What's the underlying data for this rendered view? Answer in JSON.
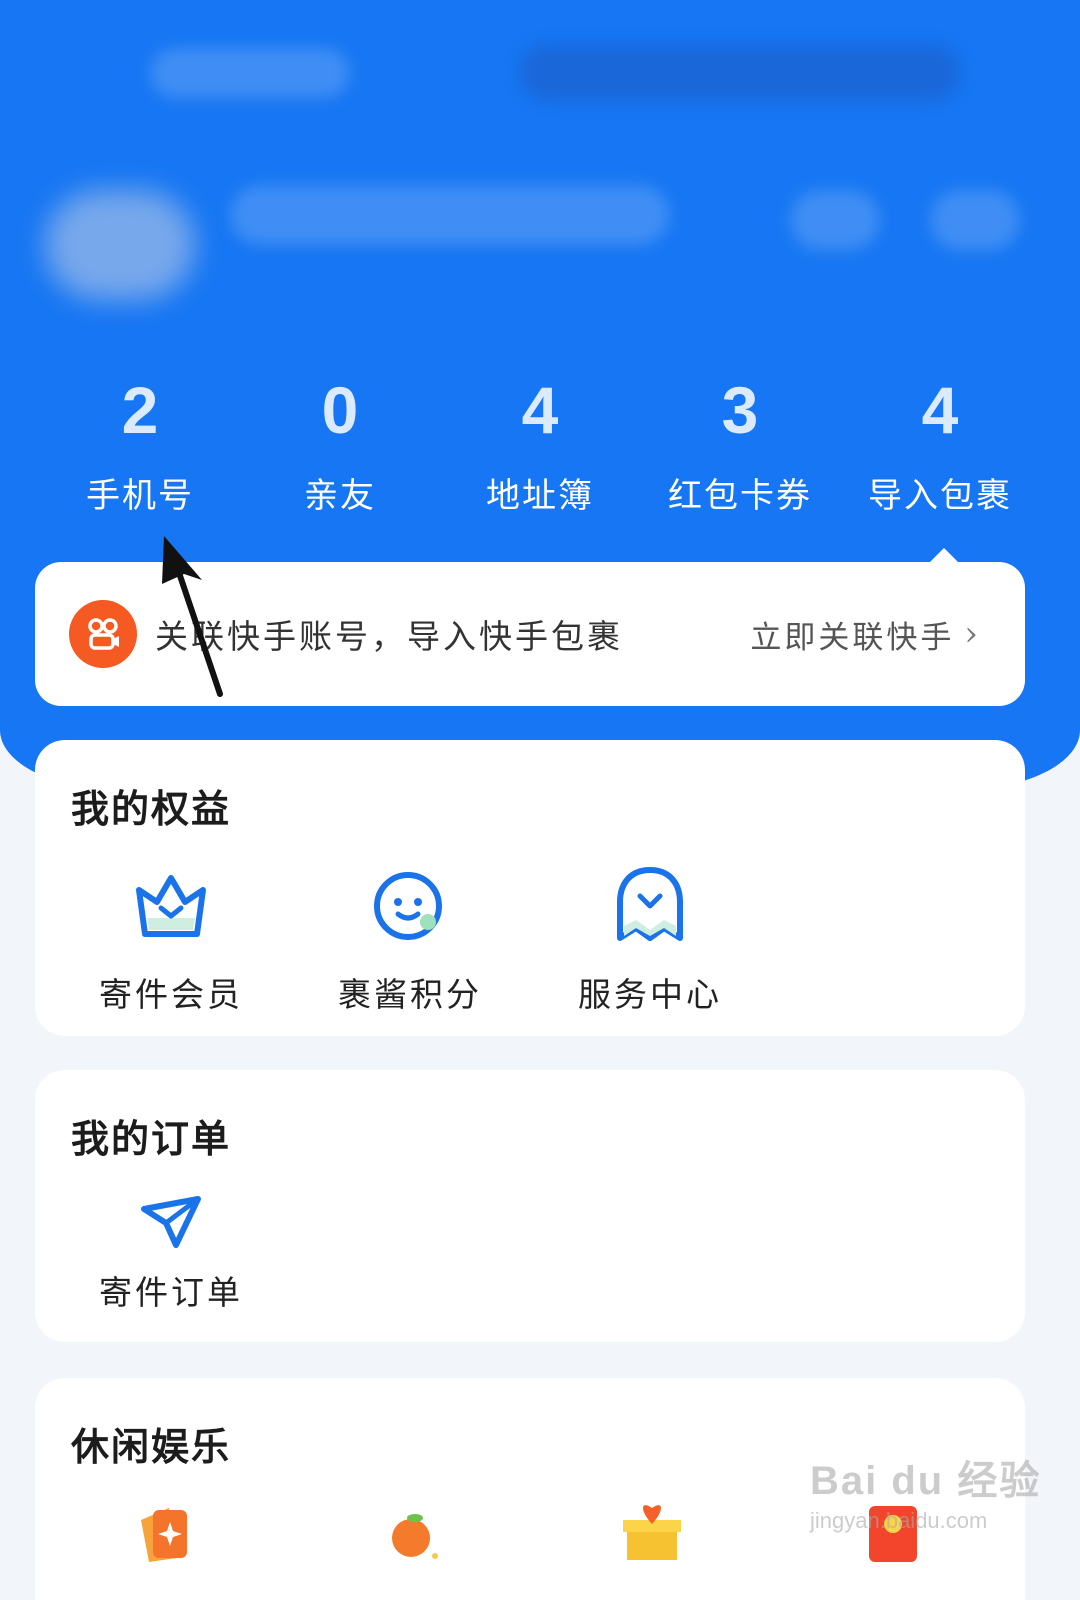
{
  "stats": [
    {
      "value": "2",
      "label": "手机号"
    },
    {
      "value": "0",
      "label": "亲友"
    },
    {
      "value": "4",
      "label": "地址簿"
    },
    {
      "value": "3",
      "label": "红包卡券"
    },
    {
      "value": "4",
      "label": "导入包裹"
    }
  ],
  "link_banner": {
    "icon": "kuaishou-icon",
    "text": "关联快手账号，导入快手包裹",
    "action": "立即关联快手",
    "chevron": "›"
  },
  "benefits": {
    "title": "我的权益",
    "items": [
      {
        "icon": "crown-icon",
        "label": "寄件会员"
      },
      {
        "icon": "smile-face-icon",
        "label": "裹酱积分"
      },
      {
        "icon": "service-heart-icon",
        "label": "服务中心"
      }
    ]
  },
  "orders": {
    "title": "我的订单",
    "items": [
      {
        "icon": "paper-plane-icon",
        "label": "寄件订单"
      }
    ]
  },
  "leisure": {
    "title": "休闲娱乐",
    "items": [
      {
        "icon": "card-star-icon"
      },
      {
        "icon": "orange-fruit-icon"
      },
      {
        "icon": "gift-box-icon"
      },
      {
        "icon": "red-envelope-icon"
      }
    ]
  },
  "watermark": {
    "big": "Bai du 经验",
    "small": "jingyan.baidu.com"
  },
  "colors": {
    "primary": "#1676f3",
    "accent_orange": "#f45a22",
    "icon_blue": "#1a73e8"
  }
}
